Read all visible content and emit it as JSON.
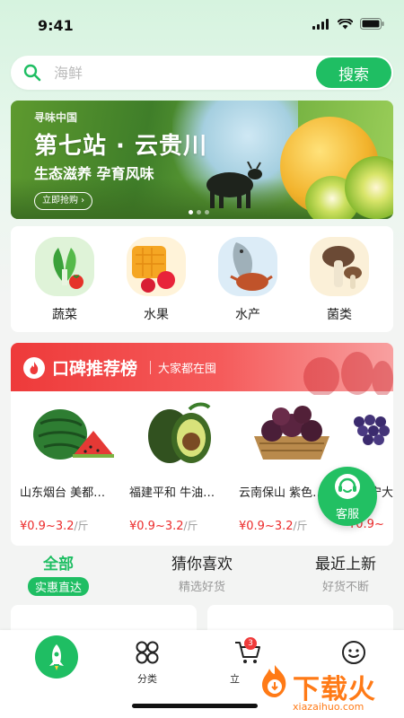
{
  "status_bar": {
    "time": "9:41"
  },
  "search": {
    "placeholder": "海鲜",
    "button_label": "搜索"
  },
  "banner": {
    "brand": "寻味中国",
    "title": "第七站 · 云贵川",
    "subtitle": "生态滋养 孕育风味",
    "cta": "立即抢购 ›",
    "slides": 3,
    "active_slide": 1
  },
  "categories": [
    {
      "label": "蔬菜",
      "icon": "vegetables-icon"
    },
    {
      "label": "水果",
      "icon": "fruits-icon"
    },
    {
      "label": "水产",
      "icon": "seafood-icon"
    },
    {
      "label": "菌类",
      "icon": "mushroom-icon"
    }
  ],
  "ranking": {
    "title": "口碑推荐榜",
    "subtitle": "大家都在囤",
    "products": [
      {
        "name": "山东烟台 美都…",
        "price": "¥0.9~3.2",
        "unit": "/斤",
        "icon": "watermelon-icon"
      },
      {
        "name": "福建平和 牛油…",
        "price": "¥0.9~3.2",
        "unit": "/斤",
        "icon": "avocado-icon"
      },
      {
        "name": "云南保山 紫色…",
        "price": "¥0.9~3.2",
        "unit": "/斤",
        "icon": "passion-fruit-icon"
      },
      {
        "name": "…宁大",
        "price": "¥0.9~",
        "unit": "",
        "icon": "grapes-icon"
      }
    ]
  },
  "customer_service": {
    "label": "客服"
  },
  "feed_tabs": [
    {
      "title": "全部",
      "subtitle": "实惠直达",
      "active": true
    },
    {
      "title": "猜你喜欢",
      "subtitle": "精选好货",
      "active": false
    },
    {
      "title": "最近上新",
      "subtitle": "好货不断",
      "active": false
    }
  ],
  "bottom_nav": {
    "home_icon": "rocket-icon",
    "category_label": "分类",
    "cart_label": "立",
    "cart_badge": "3"
  },
  "watermark": {
    "text": "下载火",
    "url": "xiazaihuo.com"
  },
  "colors": {
    "primary": "#1fbe63",
    "ranking_red": "#ee3a3a",
    "price_red": "#ec2b2b",
    "watermark_orange": "#ff7a16"
  }
}
